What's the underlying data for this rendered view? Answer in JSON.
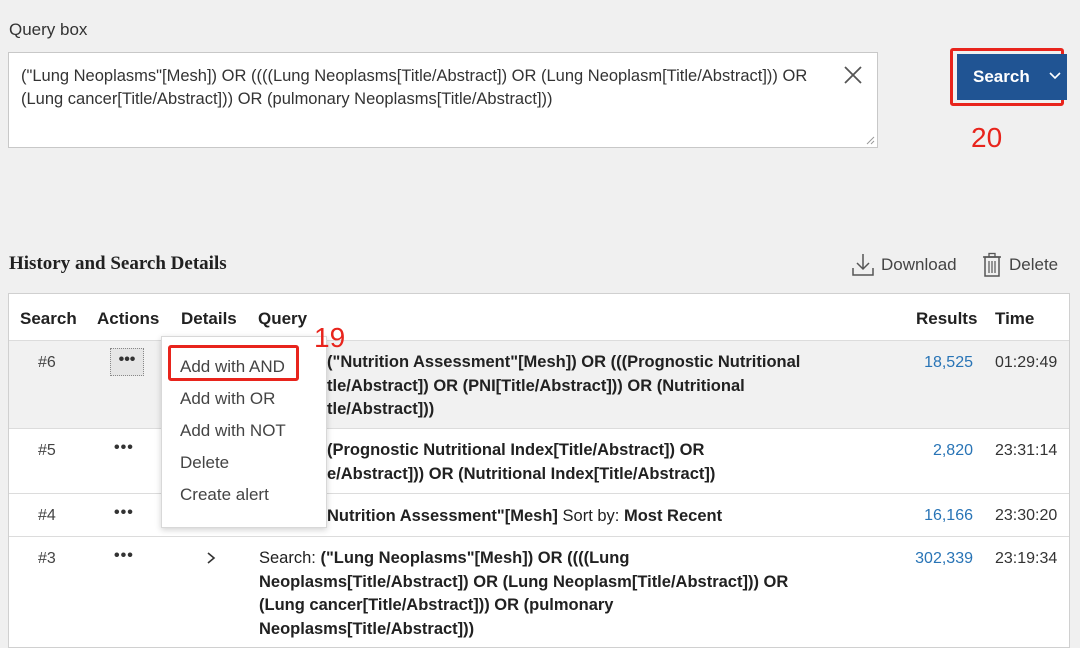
{
  "query_box": {
    "label": "Query box",
    "value": "(\"Lung Neoplasms\"[Mesh]) OR ((((Lung Neoplasms[Title/Abstract]) OR (Lung Neoplasm[Title/Abstract])) OR (Lung cancer[Title/Abstract])) OR (pulmonary Neoplasms[Title/Abstract]))"
  },
  "search_button": {
    "label": "Search"
  },
  "annotations": {
    "search": "20",
    "menu": "19"
  },
  "history": {
    "title": "History and Search Details",
    "download_label": "Download",
    "delete_label": "Delete",
    "columns": {
      "search": "Search",
      "actions": "Actions",
      "details": "Details",
      "query": "Query",
      "results": "Results",
      "time": "Time"
    },
    "rows": [
      {
        "num": "#6",
        "query_line1": "(\"Nutrition Assessment\"[Mesh]) OR (((Prognostic Nutritional",
        "query_line2": "tle/Abstract]) OR (PNI[Title/Abstract])) OR (Nutritional",
        "query_line3": "tle/Abstract]))",
        "results": "18,525",
        "time": "01:29:49"
      },
      {
        "num": "#5",
        "query_line1": "(Prognostic Nutritional Index[Title/Abstract]) OR",
        "query_line2": "e/Abstract])) OR (Nutritional Index[Title/Abstract])",
        "results": "2,820",
        "time": "23:31:14"
      },
      {
        "num": "#4",
        "query_main": "Nutrition Assessment\"[Mesh]",
        "sort_label": "Sort by:",
        "sort_value": "Most Recent",
        "results": "16,166",
        "time": "23:30:20"
      },
      {
        "num": "#3",
        "query_prefix": "Search:",
        "query_line1": "(\"Lung Neoplasms\"[Mesh]) OR ((((Lung",
        "query_line2": "Neoplasms[Title/Abstract]) OR (Lung Neoplasm[Title/Abstract])) OR",
        "query_line3": "(Lung cancer[Title/Abstract])) OR (pulmonary",
        "query_line4": "Neoplasms[Title/Abstract]))",
        "results": "302,339",
        "time": "23:19:34"
      }
    ]
  },
  "dots": "•••",
  "actions_menu": {
    "items": [
      "Add with AND",
      "Add with OR",
      "Add with NOT",
      "Delete",
      "Create alert"
    ]
  },
  "colors": {
    "accent": "#205493",
    "highlight": "#e8241c",
    "link": "#2874b6"
  }
}
